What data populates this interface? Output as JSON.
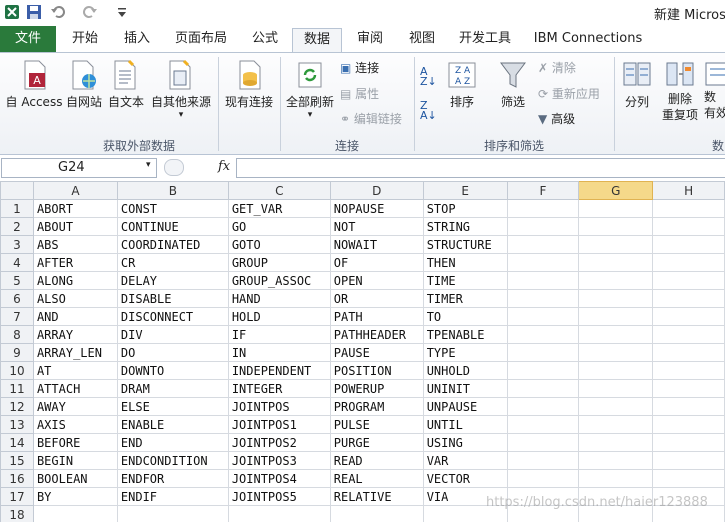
{
  "window": {
    "title": "新建 Micros"
  },
  "tabs": [
    {
      "label": "文件"
    },
    {
      "label": "开始"
    },
    {
      "label": "插入"
    },
    {
      "label": "页面布局"
    },
    {
      "label": "公式"
    },
    {
      "label": "数据"
    },
    {
      "label": "审阅"
    },
    {
      "label": "视图"
    },
    {
      "label": "开发工具"
    },
    {
      "label": "IBM Connections"
    }
  ],
  "ribbon": {
    "external": {
      "access": "自 Access",
      "web": "自网站",
      "text": "自文本",
      "other": "自其他来源",
      "existing": "现有连接",
      "group": "获取外部数据"
    },
    "connections": {
      "refresh_all": "全部刷新",
      "connections": "连接",
      "properties": "属性",
      "edit_links": "编辑链接",
      "group": "连接"
    },
    "sortfilter": {
      "sort": "排序",
      "filter": "筛选",
      "clear": "清除",
      "reapply": "重新应用",
      "advanced": "高级",
      "group": "排序和筛选"
    },
    "tools": {
      "split": "分列",
      "remove_dup_1": "删除",
      "remove_dup_2": "重复项",
      "validation_1": "数",
      "validation_2": "有效",
      "group": "数"
    }
  },
  "formula_bar": {
    "name_box": "G24",
    "fx": "fx",
    "value": ""
  },
  "sheet": {
    "columns": [
      "A",
      "B",
      "C",
      "D",
      "E",
      "F",
      "G",
      "H"
    ],
    "active_column": "G",
    "rows": [
      [
        "1",
        "ABORT",
        "CONST",
        "GET_VAR",
        "NOPAUSE",
        "STOP"
      ],
      [
        "2",
        "ABOUT",
        "CONTINUE",
        "GO",
        "NOT",
        "STRING"
      ],
      [
        "3",
        "ABS",
        "COORDINATED",
        "GOTO",
        "NOWAIT",
        "STRUCTURE"
      ],
      [
        "4",
        "AFTER",
        "CR",
        "GROUP",
        "OF",
        "THEN"
      ],
      [
        "5",
        "ALONG",
        "DELAY",
        "GROUP_ASSOC",
        "OPEN",
        "TIME"
      ],
      [
        "6",
        "ALSO",
        "DISABLE",
        "HAND",
        "OR",
        "TIMER"
      ],
      [
        "7",
        "AND",
        "DISCONNECT",
        "HOLD",
        "PATH",
        "TO"
      ],
      [
        "8",
        "ARRAY",
        "DIV",
        "IF",
        "PATHHEADER",
        "TPENABLE"
      ],
      [
        "9",
        "ARRAY_LEN",
        "DO",
        "IN",
        "PAUSE",
        "TYPE"
      ],
      [
        "10",
        "AT",
        "DOWNTO",
        "INDEPENDENT",
        "POSITION",
        "UNHOLD"
      ],
      [
        "11",
        "ATTACH",
        "DRAM",
        "INTEGER",
        "POWERUP",
        "UNINIT"
      ],
      [
        "12",
        "AWAY",
        "ELSE",
        "JOINTPOS",
        "PROGRAM",
        "UNPAUSE"
      ],
      [
        "13",
        "AXIS",
        "ENABLE",
        "JOINTPOS1",
        "PULSE",
        "UNTIL"
      ],
      [
        "14",
        "BEFORE",
        "END",
        "JOINTPOS2",
        "PURGE",
        "USING"
      ],
      [
        "15",
        "BEGIN",
        "ENDCONDITION",
        "JOINTPOS3",
        "READ",
        "VAR"
      ],
      [
        "16",
        "BOOLEAN",
        "ENDFOR",
        "JOINTPOS4",
        "REAL",
        "VECTOR"
      ],
      [
        "17",
        "BY",
        "ENDIF",
        "JOINTPOS5",
        "RELATIVE",
        "VIA"
      ],
      [
        "18",
        "",
        "",
        "",
        "",
        ""
      ]
    ]
  },
  "watermark": "https://blog.csdn.net/haier123888",
  "colors": {
    "file_tab": "#2a7a3b",
    "active_header": "#f5d98a"
  }
}
